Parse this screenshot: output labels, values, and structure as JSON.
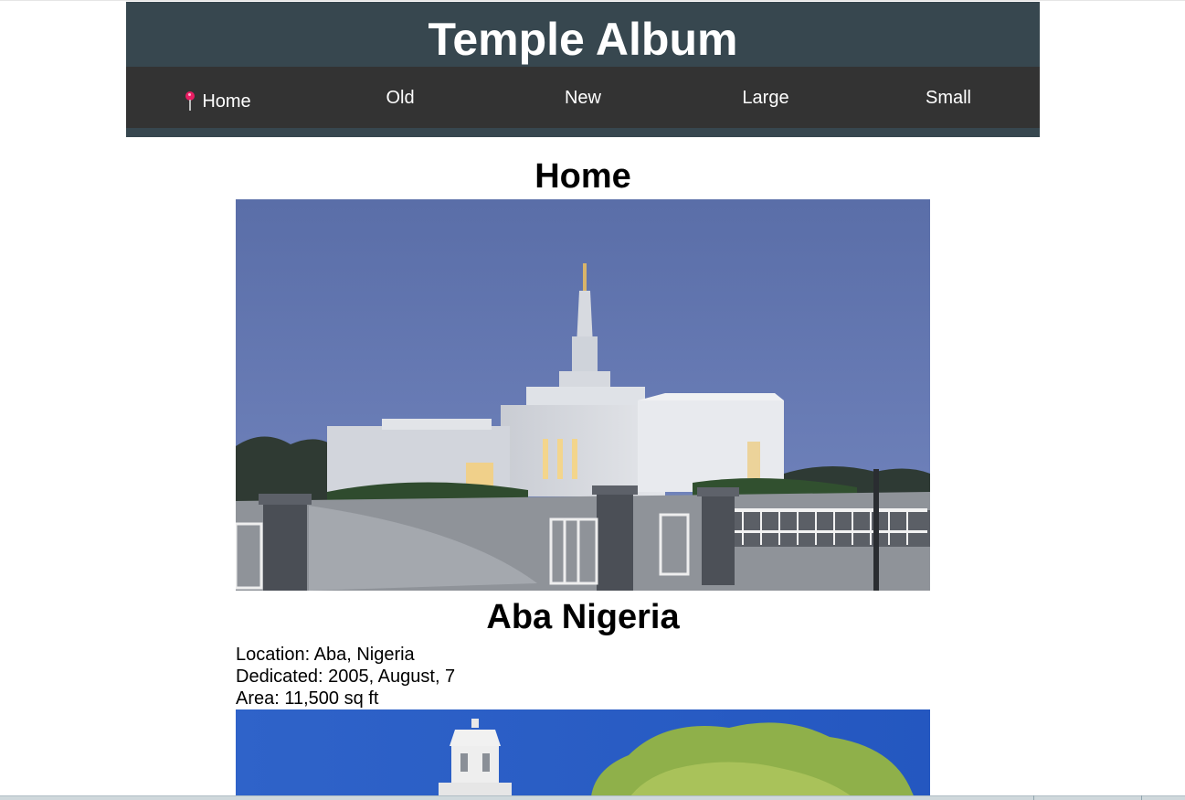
{
  "site": {
    "title": "Temple Album"
  },
  "nav": {
    "items": [
      {
        "label": "Home",
        "icon": "pin-icon",
        "active": true
      },
      {
        "label": "Old"
      },
      {
        "label": "New"
      },
      {
        "label": "Large"
      },
      {
        "label": "Small"
      }
    ]
  },
  "main": {
    "heading": "Home",
    "temples": [
      {
        "name": "Aba Nigeria",
        "location": "Location: Aba, Nigeria",
        "dedicated": "Dedicated: 2005, August, 7",
        "area": "Area: 11,500 sq ft"
      }
    ]
  },
  "colors": {
    "header_bg": "#37474f",
    "nav_bg": "#333333",
    "pin": "#e91e63"
  }
}
